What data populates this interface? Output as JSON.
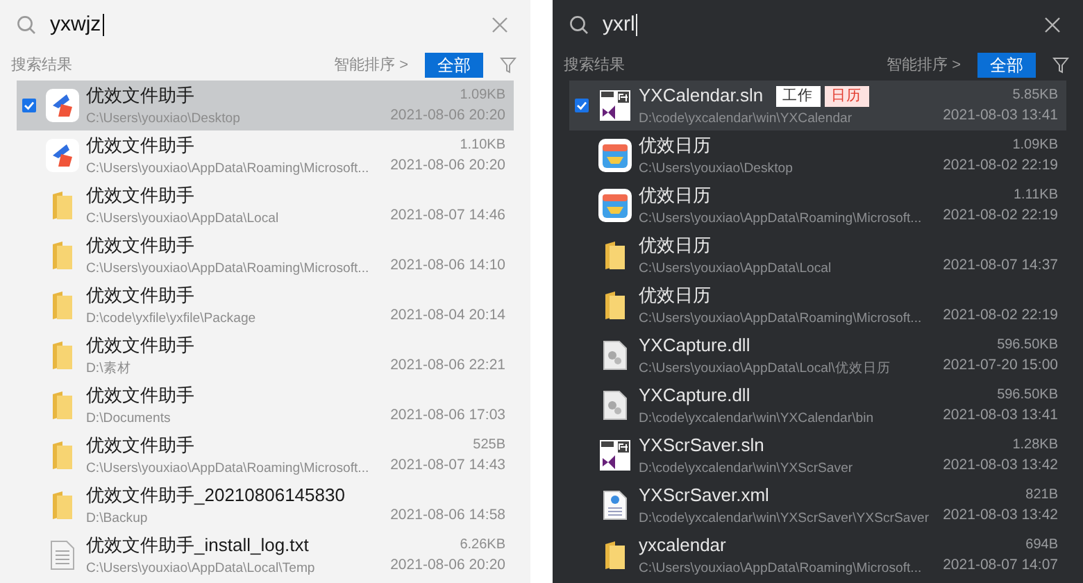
{
  "panels": [
    {
      "kind": "light",
      "search": {
        "value": "yxwjz"
      },
      "results_label": "搜索结果",
      "sort": "智能排序 >",
      "filter_button": "全部",
      "rows": [
        {
          "kind": "app",
          "name": "优效文件助手",
          "path": "C:\\Users\\youxiao\\Desktop",
          "size": "1.09KB",
          "date": "2021-08-06 20:20",
          "selected": true
        },
        {
          "kind": "app",
          "name": "优效文件助手",
          "path": "C:\\Users\\youxiao\\AppData\\Roaming\\Microsoft...",
          "size": "1.10KB",
          "date": "2021-08-06 20:20",
          "selected": false
        },
        {
          "kind": "folder",
          "name": "优效文件助手",
          "path": "C:\\Users\\youxiao\\AppData\\Local",
          "date": "2021-08-07 14:46",
          "selected": false
        },
        {
          "kind": "folder",
          "name": "优效文件助手",
          "path": "C:\\Users\\youxiao\\AppData\\Roaming\\Microsoft...",
          "date": "2021-08-06 14:10",
          "selected": false
        },
        {
          "kind": "folder",
          "name": "优效文件助手",
          "path": "D:\\code\\yxfile\\yxfile\\Package",
          "date": "2021-08-04 20:14",
          "selected": false
        },
        {
          "kind": "folder",
          "name": "优效文件助手",
          "path": "D:\\素材",
          "date": "2021-08-06 22:21",
          "selected": false
        },
        {
          "kind": "folder",
          "name": "优效文件助手",
          "path": "D:\\Documents",
          "date": "2021-08-06 17:03",
          "selected": false
        },
        {
          "kind": "folder",
          "name": "优效文件助手",
          "path": "C:\\Users\\youxiao\\AppData\\Roaming\\Microsoft...",
          "size": "525B",
          "date": "2021-08-07 14:43",
          "selected": false
        },
        {
          "kind": "folder",
          "name": "优效文件助手_20210806145830",
          "path": "D:\\Backup",
          "date": "2021-08-06 14:58",
          "selected": false
        },
        {
          "kind": "text",
          "name": "优效文件助手_install_log.txt",
          "path": "C:\\Users\\youxiao\\AppData\\Local\\Temp",
          "size": "6.26KB",
          "date": "2021-08-06 20:20",
          "selected": false
        }
      ]
    },
    {
      "kind": "dark",
      "search": {
        "value": "yxrl"
      },
      "results_label": "搜索结果",
      "sort": "智能排序 >",
      "filter_button": "全部",
      "rows": [
        {
          "kind": "solution",
          "name": "YXCalendar.sln",
          "tags": [
            {
              "label": "工作",
              "color": "#ffffff"
            },
            {
              "label": "日历",
              "color": "#fde2e0"
            }
          ],
          "path": "D:\\code\\yxcalendar\\win\\YXCalendar",
          "size": "5.85KB",
          "date": "2021-08-03 13:41",
          "selected": true
        },
        {
          "kind": "calendar",
          "name": "优效日历",
          "path": "C:\\Users\\youxiao\\Desktop",
          "size": "1.09KB",
          "date": "2021-08-02 22:19",
          "selected": false
        },
        {
          "kind": "calendar",
          "name": "优效日历",
          "path": "C:\\Users\\youxiao\\AppData\\Roaming\\Microsoft...",
          "size": "1.11KB",
          "date": "2021-08-02 22:19",
          "selected": false
        },
        {
          "kind": "folder",
          "name": "优效日历",
          "path": "C:\\Users\\youxiao\\AppData\\Local",
          "date": "2021-08-07 14:37",
          "selected": false
        },
        {
          "kind": "folder",
          "name": "优效日历",
          "path": "C:\\Users\\youxiao\\AppData\\Roaming\\Microsoft...",
          "date": "2021-08-02 22:19",
          "selected": false
        },
        {
          "kind": "library",
          "name": "YXCapture.dll",
          "path": "C:\\Users\\youxiao\\AppData\\Local\\优效日历",
          "size": "596.50KB",
          "date": "2021-07-20 15:00",
          "selected": false
        },
        {
          "kind": "library",
          "name": "YXCapture.dll",
          "path": "D:\\code\\yxcalendar\\win\\YXCalendar\\bin",
          "size": "596.50KB",
          "date": "2021-08-03 13:41",
          "selected": false
        },
        {
          "kind": "solution",
          "name": "YXScrSaver.sln",
          "path": "D:\\code\\yxcalendar\\win\\YXScrSaver",
          "size": "1.28KB",
          "date": "2021-08-03 13:42",
          "selected": false
        },
        {
          "kind": "xml",
          "name": "YXScrSaver.xml",
          "path": "D:\\code\\yxcalendar\\win\\YXScrSaver\\YXScrSaver",
          "size": "821B",
          "date": "2021-08-03 13:42",
          "selected": false
        },
        {
          "kind": "folder",
          "name": "yxcalendar",
          "path": "C:\\Users\\youxiao\\AppData\\Roaming\\Microsoft...",
          "size": "694B",
          "date": "2021-08-07 14:07",
          "selected": false
        }
      ]
    }
  ]
}
